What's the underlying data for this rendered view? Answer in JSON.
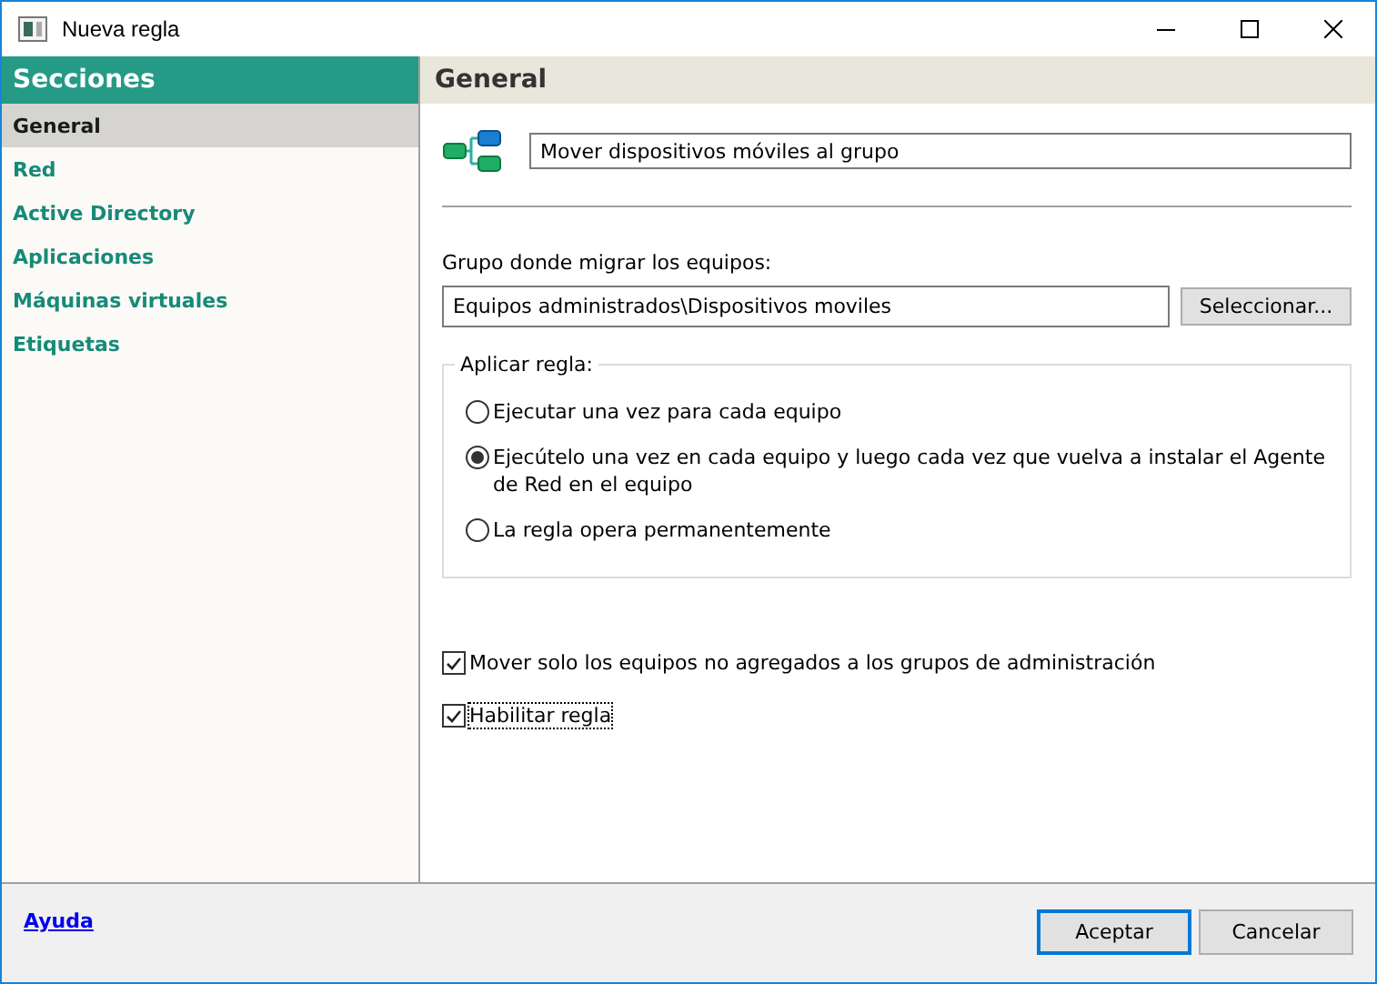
{
  "window": {
    "title": "Nueva regla",
    "controls": [
      {
        "kind": "minimize"
      },
      {
        "kind": "maximize"
      },
      {
        "kind": "close"
      }
    ]
  },
  "sidebar": {
    "title": "Secciones",
    "items": [
      {
        "label": "General",
        "selected": true
      },
      {
        "label": "Red",
        "selected": false
      },
      {
        "label": "Active Directory",
        "selected": false
      },
      {
        "label": "Aplicaciones",
        "selected": false
      },
      {
        "label": "Máquinas virtuales",
        "selected": false
      },
      {
        "label": "Etiquetas",
        "selected": false
      }
    ]
  },
  "panel": {
    "title": "General",
    "rule_name": "Mover dispositivos móviles al grupo",
    "group_label": "Grupo donde migrar los equipos:",
    "group_value": "Equipos administrados\\Dispositivos moviles",
    "select_button": "Seleccionar...",
    "apply": {
      "legend": "Aplicar regla:",
      "options": [
        {
          "label": "Ejecutar una vez para cada equipo",
          "selected": false
        },
        {
          "label": "Ejecútelo una vez en cada equipo y luego cada vez que vuelva a instalar el Agente de Red en el equipo",
          "selected": true
        },
        {
          "label": "La regla opera permanentemente",
          "selected": false
        }
      ]
    },
    "checkboxes": [
      {
        "label": "Mover solo los equipos no agregados a los grupos de administración",
        "checked": true,
        "focused": false
      },
      {
        "label": "Habilitar regla",
        "checked": true,
        "focused": true
      }
    ]
  },
  "footer": {
    "help_link": "Ayuda",
    "buttons": [
      {
        "label": "Aceptar",
        "default": true
      },
      {
        "label": "Cancelar",
        "default": false
      }
    ]
  }
}
